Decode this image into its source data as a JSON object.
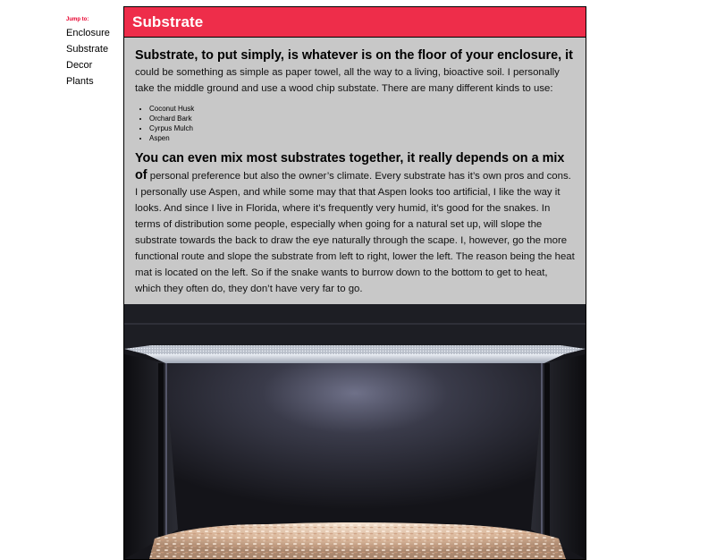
{
  "sidebar": {
    "jump_label": "Jump to:",
    "links": [
      {
        "label": "Enclosure"
      },
      {
        "label": "Substrate"
      },
      {
        "label": "Decor"
      },
      {
        "label": "Plants"
      }
    ]
  },
  "section": {
    "title": "Substrate",
    "intro": {
      "lead": "Substrate, to put simply, is whatever is on the floor of your enclosure, it",
      "body": " could be something as simple as paper towel, all the way to a living, bioactive soil. I personally take the middle ground and use a wood chip substate. There are many different kinds to use:"
    },
    "substrate_types": [
      "Coconut Husk",
      "Orchard Bark",
      "Cyrpus Mulch",
      "Aspen"
    ],
    "mixing": {
      "lead": "You can even mix most substrates together, it really depends on a mix of",
      "body": " personal preference but also the owner’s climate. Every substrate has it’s own pros and cons. I personally use Aspen, and while some may that that Aspen looks too artificial, I like the way it looks. And since I live in Florida, where it’s frequently very humid, it’s good for the snakes. In terms of distribution some people, especially when going for a natural set up, will slope the substrate towards the back to draw the eye naturally through the scape. I, however, go the more functional route and slope the substrate from left to right, lower the left. The reason being the heat mat is located on the left. So if the snake wants to burrow down to the bottom to get to heat, which they often do, they don’t have very far to go."
    }
  },
  "colors": {
    "accent": "#ee2d4a",
    "jump_label": "#e8002d",
    "panel_bg": "#c8c8c8"
  }
}
